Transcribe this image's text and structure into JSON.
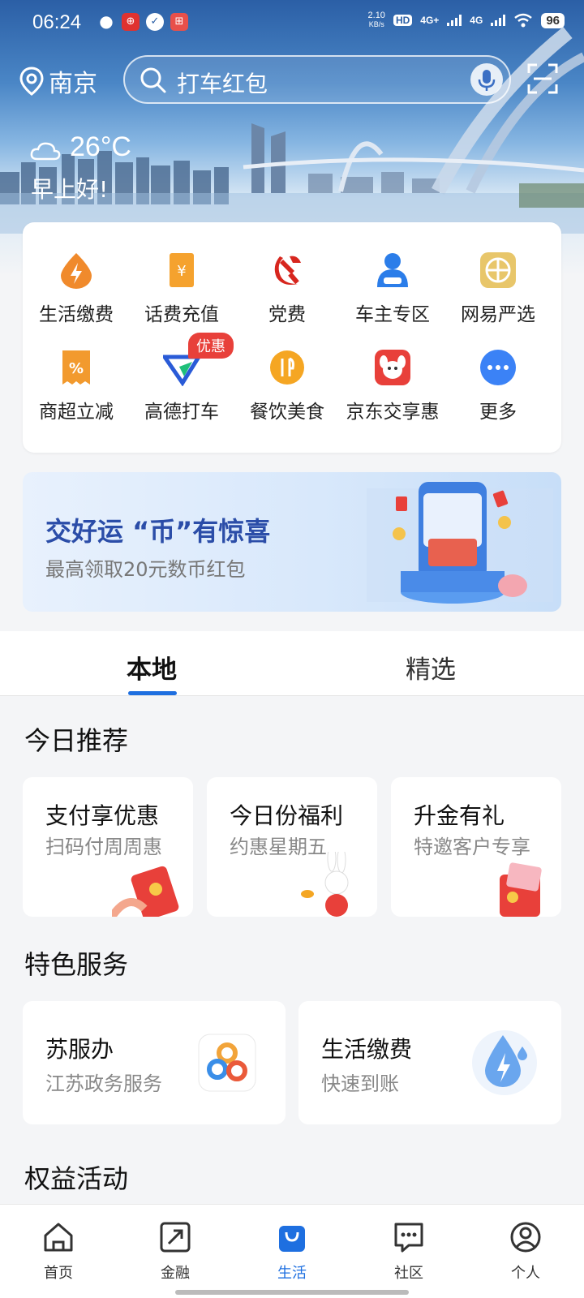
{
  "status": {
    "time": "06:24",
    "speed_top": "2.10",
    "speed_bottom": "KB/s",
    "hd": "HD",
    "net1": "4G+",
    "net2": "4G",
    "battery": "96"
  },
  "header": {
    "city": "南京",
    "search_placeholder": "打车红包"
  },
  "weather": {
    "temp": "26°C",
    "greeting": "早上好!"
  },
  "quick": {
    "items": [
      {
        "label": "生活缴费",
        "icon": "lightning-drop-icon",
        "color": "#f08a2c"
      },
      {
        "label": "话费充值",
        "icon": "phone-recharge-icon",
        "color": "#f5a22e"
      },
      {
        "label": "党费",
        "icon": "party-emblem-icon",
        "color": "#d7261e"
      },
      {
        "label": "车主专区",
        "icon": "car-owner-icon",
        "color": "#2b7de9"
      },
      {
        "label": "网易严选",
        "icon": "netease-icon",
        "color": "#e8c66a"
      },
      {
        "label": "商超立减",
        "icon": "percent-coupon-icon",
        "color": "#f29a2e"
      },
      {
        "label": "高德打车",
        "icon": "amap-taxi-icon",
        "color": "#2a5bd7"
      },
      {
        "label": "餐饮美食",
        "icon": "food-icon",
        "color": "#f5a623"
      },
      {
        "label": "京东交享惠",
        "icon": "jd-dog-icon",
        "color": "#e8403a"
      },
      {
        "label": "更多",
        "icon": "more-icon",
        "color": "#3b82f6"
      }
    ],
    "badge": "优惠"
  },
  "banner": {
    "title": "交好运 “币”有惊喜",
    "subtitle": "最高领取20元数币红包"
  },
  "tabs": [
    {
      "label": "本地"
    },
    {
      "label": "精选"
    }
  ],
  "sections": {
    "today": "今日推荐",
    "special": "特色服务",
    "rights": "权益活动"
  },
  "recommend": [
    {
      "title": "支付享优惠",
      "subtitle": "扫码付周周惠"
    },
    {
      "title": "今日份福利",
      "subtitle": "约惠星期五"
    },
    {
      "title": "升金有礼",
      "subtitle": "特邀客户专享"
    }
  ],
  "services": [
    {
      "title": "苏服办",
      "subtitle": "江苏政务服务"
    },
    {
      "title": "生活缴费",
      "subtitle": "快速到账"
    }
  ],
  "nav": [
    {
      "label": "首页"
    },
    {
      "label": "金融"
    },
    {
      "label": "生活"
    },
    {
      "label": "社区"
    },
    {
      "label": "个人"
    }
  ]
}
